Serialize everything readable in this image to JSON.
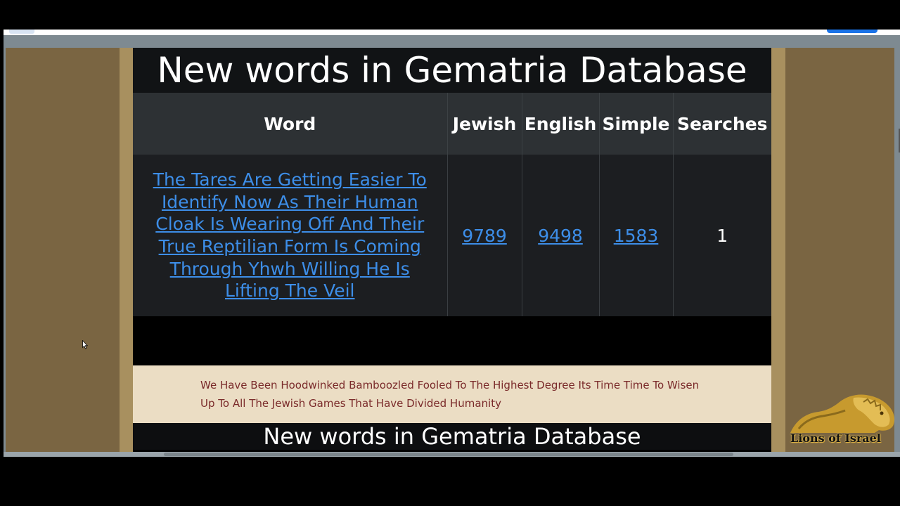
{
  "page": {
    "heading": "New words in Gematria Database",
    "heading_repeat": "New words in Gematria Database"
  },
  "table": {
    "headers": [
      "Word",
      "Jewish",
      "English",
      "Simple",
      "Searches"
    ],
    "rows": [
      {
        "word": "The Tares Are Getting Easier To Identify Now As Their Human Cloak Is Wearing Off And Their True Reptilian Form Is Coming Through Yhwh Willing He Is Lifting The Veil",
        "jewish": "9789",
        "english": "9498",
        "simple": "1583",
        "searches": "1"
      }
    ]
  },
  "quote": {
    "text": "We Have Been Hoodwinked Bamboozled Fooled To The Highest Degree Its Time Time To Wisen Up To All The Jewish Games That Have Divided Humanity"
  },
  "watermark": {
    "text": "Lions of Israel"
  },
  "colors": {
    "link": "#3d8ee8",
    "page_bg": "#7a6542",
    "column_bg": "#a8905f",
    "quote_bg": "#ebddc4",
    "quote_text": "#7a2a2a"
  }
}
